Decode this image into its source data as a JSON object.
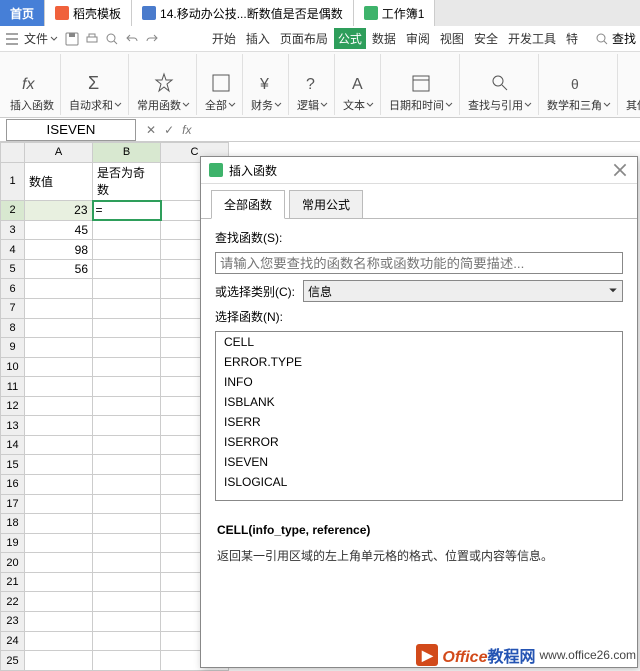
{
  "doctabs": {
    "home": "首页",
    "dk": "稻壳模板",
    "wps_w": "14.移动办公技...断数值是否是偶数",
    "wps_s": "工作簿1"
  },
  "menubar": {
    "file": "文件",
    "tabs": [
      "开始",
      "插入",
      "页面布局",
      "公式",
      "数据",
      "审阅",
      "视图",
      "安全",
      "开发工具",
      "特"
    ],
    "active_tab": "公式",
    "search": "查找"
  },
  "ribbon": [
    {
      "label": "插入函数",
      "icon": "fx"
    },
    {
      "label": "自动求和",
      "icon": "sum",
      "drop": true
    },
    {
      "label": "常用函数",
      "icon": "star",
      "drop": true
    },
    {
      "label": "全部",
      "icon": "all",
      "drop": true
    },
    {
      "label": "财务",
      "icon": "money",
      "drop": true
    },
    {
      "label": "逻辑",
      "icon": "logic",
      "drop": true
    },
    {
      "label": "文本",
      "icon": "text",
      "drop": true
    },
    {
      "label": "日期和时间",
      "icon": "date",
      "drop": true
    },
    {
      "label": "查找与引用",
      "icon": "lookup",
      "drop": true
    },
    {
      "label": "数学和三角",
      "icon": "math",
      "drop": true
    },
    {
      "label": "其他函数",
      "icon": "other",
      "drop": true
    }
  ],
  "namebox": "ISEVEN",
  "columns": [
    "A",
    "B",
    "C"
  ],
  "rows": [
    {
      "n": 1,
      "A": "数值",
      "B": "是否为奇数"
    },
    {
      "n": 2,
      "A": "23",
      "B": "="
    },
    {
      "n": 3,
      "A": "45"
    },
    {
      "n": 4,
      "A": "98"
    },
    {
      "n": 5,
      "A": "56"
    },
    {
      "n": 6
    },
    {
      "n": 7
    },
    {
      "n": 8
    },
    {
      "n": 9
    },
    {
      "n": 10
    },
    {
      "n": 11
    },
    {
      "n": 12
    },
    {
      "n": 13
    },
    {
      "n": 14
    },
    {
      "n": 15
    },
    {
      "n": 16
    },
    {
      "n": 17
    },
    {
      "n": 18
    },
    {
      "n": 19
    },
    {
      "n": 20
    },
    {
      "n": 21
    },
    {
      "n": 22
    },
    {
      "n": 23
    },
    {
      "n": 24
    },
    {
      "n": 25
    }
  ],
  "dialog": {
    "title": "插入函数",
    "tabs": [
      "全部函数",
      "常用公式"
    ],
    "active_tab": 0,
    "search_label": "查找函数(S):",
    "search_placeholder": "请输入您要查找的函数名称或函数功能的简要描述...",
    "category_label": "或选择类别(C):",
    "category_value": "信息",
    "select_label": "选择函数(N):",
    "functions": [
      "CELL",
      "ERROR.TYPE",
      "INFO",
      "ISBLANK",
      "ISERR",
      "ISERROR",
      "ISEVEN",
      "ISLOGICAL"
    ],
    "signature": "CELL(info_type, reference)",
    "description": "返回某一引用区域的左上角单元格的格式、位置或内容等信息。"
  },
  "watermark": {
    "brand1": "Office",
    "brand2": "教程网",
    "url": "www.office26.com"
  }
}
